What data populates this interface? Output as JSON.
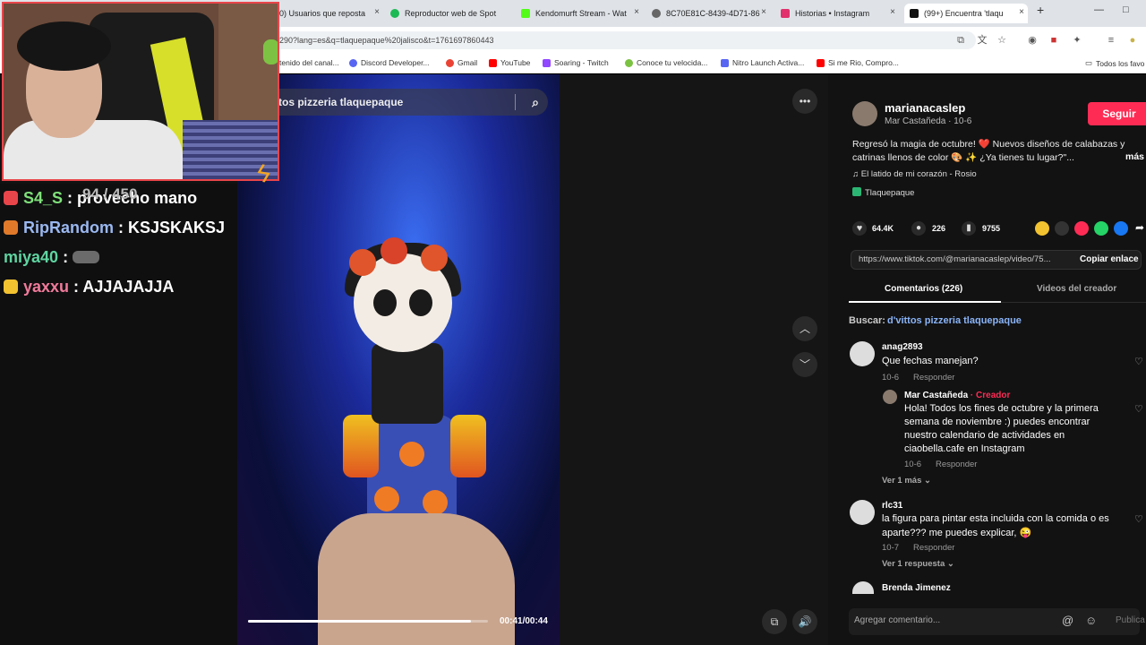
{
  "browser": {
    "tabs": [
      {
        "label": "0) Usuarios que reposta",
        "fav": "#d44"
      },
      {
        "label": "Reproductor web de Spot",
        "fav": "#1db954"
      },
      {
        "label": "Kendomurft Stream - Wat",
        "fav": "#53fc18"
      },
      {
        "label": "8C70E81C-8439-4D71-86",
        "fav": "#666"
      },
      {
        "label": "Historias • Instagram",
        "fav": "#e1306c"
      },
      {
        "label": "(99+) Encuentra 'tlaqu",
        "fav": "#111"
      }
    ],
    "url": "290?lang=es&q=tlaquepaque%20jalisco&t=1761697860443",
    "bookmarks": [
      {
        "label": "tenido del canal...",
        "color": "#c00"
      },
      {
        "label": "Discord Developer...",
        "color": "#5865f2"
      },
      {
        "label": "Gmail",
        "color": "#ea4335"
      },
      {
        "label": "YouTube",
        "color": "#f00"
      },
      {
        "label": "Soaring - Twitch",
        "color": "#9146ff"
      },
      {
        "label": "Conoce tu velocida...",
        "color": "#7cc242"
      },
      {
        "label": "Nitro Launch Activa...",
        "color": "#5865f2"
      },
      {
        "label": "Si me Rio, Compro...",
        "color": "#f00"
      }
    ],
    "bookmarks_folder": "Todos los favo"
  },
  "stream": {
    "counter": "94 / 450",
    "chat": [
      {
        "user": "S4_S",
        "user_color": "#7fe07a",
        "message": "provecho mano",
        "badge": "#e8454a"
      },
      {
        "user": "RipRandom",
        "user_color": "#9ab8f0",
        "message": "KSJSKAKSJ",
        "badge": "#e07a2a"
      },
      {
        "user": "miya40",
        "user_color": "#5fd4a0",
        "message": "",
        "badge": ""
      },
      {
        "user": "yaxxu",
        "user_color": "#f07a9a",
        "message": "AJJAJAJJA",
        "badge": "#f2c230"
      }
    ]
  },
  "video": {
    "search_text": "tos pizzeria tlaquepaque",
    "time": "00:41/00:44",
    "progress": 0.93
  },
  "post": {
    "username": "marianacaslep",
    "display": "Mar Castañeda · 10-6",
    "follow_label": "Seguir",
    "caption_line1": "Regresó la magia de octubre! ❤️  Nuevos diseños de calabazas y",
    "caption_line2": "catrinas llenos de color 🎨 ✨ ¿Ya tienes tu lugar?\"...",
    "more_label": "más",
    "music": "♫  El latido de mi corazón - Rosio",
    "location": "Tlaquepaque",
    "likes": "64.4K",
    "comments": "226",
    "saves": "9755",
    "link": "https://www.tiktok.com/@marianacaslep/video/75...",
    "copy_label": "Copiar enlace",
    "tab_comments": "Comentarios (226)",
    "tab_videos": "Videos del creador",
    "search_label": "Buscar:",
    "search_query": "d'vittos pizzeria tlaquepaque",
    "comment_placeholder": "Agregar comentario...",
    "publish_label": "Publica"
  },
  "comments": [
    {
      "user": "anag2893",
      "text": "Que fechas manejan?",
      "date": "10-6",
      "reply": "Responder"
    },
    {
      "user": "Mar Castañeda",
      "creator": "· Creador",
      "text1": "Hola! Todos los fines de octubre y la primera",
      "text2": "semana de noviembre :) puedes encontrar",
      "text3": "nuestro calendario de actividades en",
      "text4": "ciaobella.cafe en Instagram",
      "date": "10-6",
      "reply": "Responder",
      "more": "Ver 1 más"
    },
    {
      "user": "rlc31",
      "text1": "la figura para pintar esta incluida con la comida o es",
      "text2": "aparte??? me puedes explicar, 😜",
      "date": "10-7",
      "reply": "Responder",
      "more": "Ver 1 respuesta"
    },
    {
      "user": "Brenda Jimenez"
    }
  ]
}
